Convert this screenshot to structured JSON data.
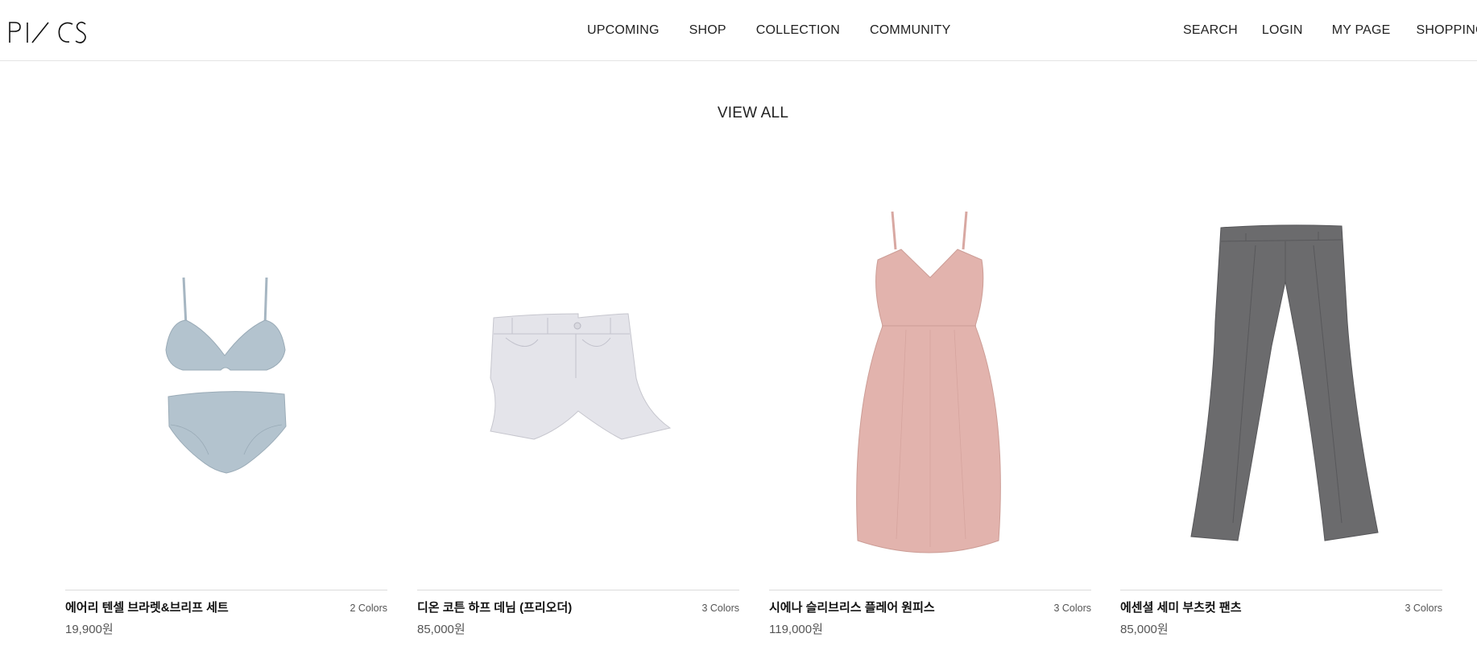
{
  "header": {
    "main_nav": [
      "UPCOMING",
      "SHOP",
      "COLLECTION",
      "COMMUNITY"
    ],
    "util_nav": {
      "search": "SEARCH",
      "login": "LOGIN",
      "mypage": "MY PAGE",
      "bag": "SHOPPING BAG"
    }
  },
  "view_all": "VIEW ALL",
  "products": [
    {
      "name": "에어리 텐셀 브라렛&브리프 세트",
      "colors": "2 Colors",
      "price": "19,900원",
      "image": "bralette-brief-set",
      "color": "#b3c3ce"
    },
    {
      "name": "디온 코튼 하프 데님 (프리오더)",
      "colors": "3 Colors",
      "price": "85,000원",
      "image": "white-denim-shorts",
      "color": "#e4e4ea"
    },
    {
      "name": "시에나 슬리브리스 플레어 원피스",
      "colors": "3 Colors",
      "price": "119,000원",
      "image": "pink-slip-dress",
      "color": "#e2b3ad"
    },
    {
      "name": "에센셜 세미 부츠컷 팬츠",
      "colors": "3 Colors",
      "price": "85,000원",
      "image": "grey-bootcut-pants",
      "color": "#6b6b6d"
    }
  ]
}
